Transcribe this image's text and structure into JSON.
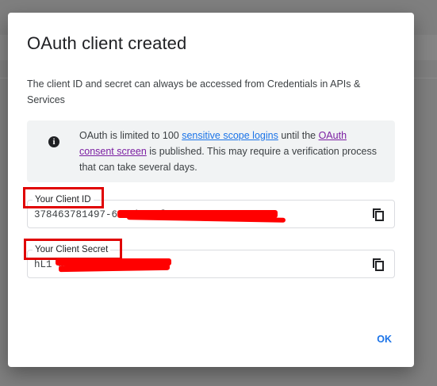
{
  "dialog": {
    "title": "OAuth client created",
    "description": "The client ID and secret can always be accessed from Credentials in APIs & Services",
    "info": {
      "icon": "info-icon",
      "text_before": "OAuth is limited to 100 ",
      "link_scopes": "sensitive scope logins",
      "text_middle": " until the ",
      "link_consent": "OAuth consent screen",
      "text_after": " is published. This may require a verification process that can take several days."
    },
    "client_id": {
      "label": "Your Client ID",
      "value_visible": "378463781497-6                                  24br6tf.apps.gc"
    },
    "client_secret": {
      "label": "Your Client Secret",
      "value_visible": "hL1                                  Jw"
    },
    "ok_label": "OK"
  },
  "colors": {
    "accent": "#1a73e8",
    "visited_link": "#7b1fa2",
    "redaction": "#ff0000",
    "overlay": "#7f7f7f"
  }
}
